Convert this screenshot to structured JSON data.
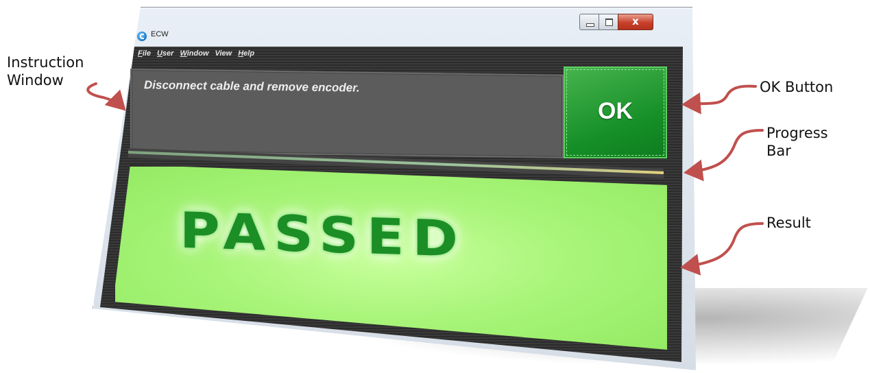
{
  "window": {
    "title": "ECW",
    "close_glyph": "x"
  },
  "menu": {
    "items": [
      "File",
      "User",
      "Window",
      "View",
      "Help"
    ]
  },
  "instruction": {
    "text": "Disconnect cable and remove encoder."
  },
  "ok_button": {
    "label": "OK",
    "color": "#1e9a2e"
  },
  "progress": {
    "percent": 100
  },
  "result": {
    "text": "PASSED",
    "background_color": "#a9f57a",
    "text_color": "#1b8e25"
  },
  "annotations": {
    "instruction_line1": "Instruction",
    "instruction_line2": "Window",
    "ok_button": "OK Button",
    "progress_line1": "Progress",
    "progress_line2": "Bar",
    "result": "Result",
    "arrow_color": "#c0504d"
  }
}
